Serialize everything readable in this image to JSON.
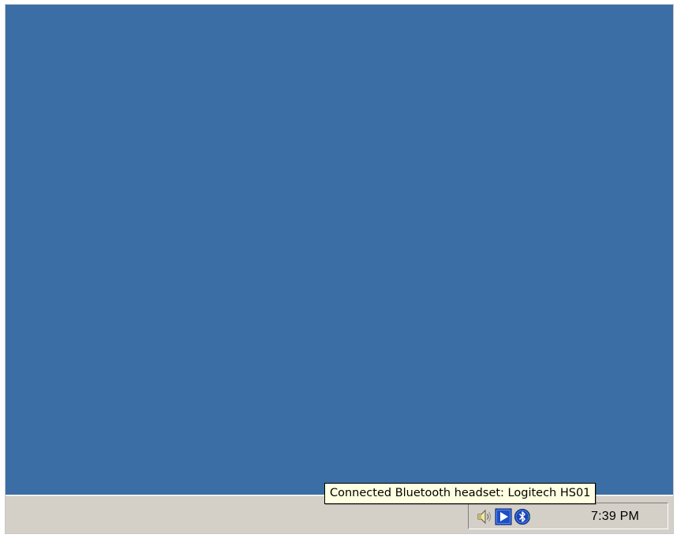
{
  "desktop": {
    "background_color": "#3a6ea5"
  },
  "taskbar": {
    "background_color": "#d4d0c8",
    "tray": {
      "icons": [
        {
          "name": "speaker-volume-icon"
        },
        {
          "name": "media-play-icon"
        },
        {
          "name": "bluetooth-icon"
        }
      ],
      "clock": "7:39 PM"
    }
  },
  "tooltip": {
    "text": "Connected Bluetooth headset: Logitech HS01",
    "background_color": "#ffffe1"
  }
}
